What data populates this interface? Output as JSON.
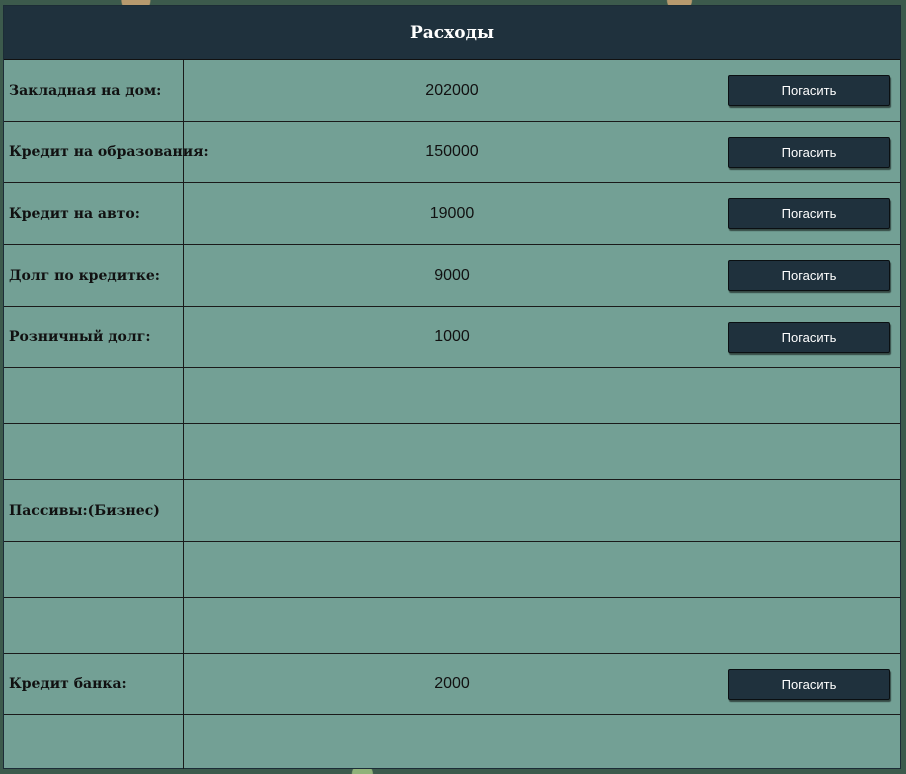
{
  "header": {
    "title": "Расходы"
  },
  "rows": [
    {
      "label": "Закладная на дом:",
      "value": "202000",
      "button": "Погасить"
    },
    {
      "label": "Кредит на образования:",
      "value": "150000",
      "button": "Погасить"
    },
    {
      "label": "Кредит на авто:",
      "value": "19000",
      "button": "Погасить"
    },
    {
      "label": "Долг по кредитке:",
      "value": "9000",
      "button": "Погасить"
    },
    {
      "label": "Розничный долг:",
      "value": "1000",
      "button": "Погасить"
    },
    {
      "label": "",
      "value": ""
    },
    {
      "label": "",
      "value": ""
    },
    {
      "label": "Пассивы:(Бизнес)",
      "value": ""
    },
    {
      "label": "",
      "value": ""
    },
    {
      "label": "",
      "value": ""
    },
    {
      "label": "Кредит банка:",
      "value": "2000",
      "button": "Погасить"
    },
    {
      "label": "",
      "value": ""
    }
  ]
}
